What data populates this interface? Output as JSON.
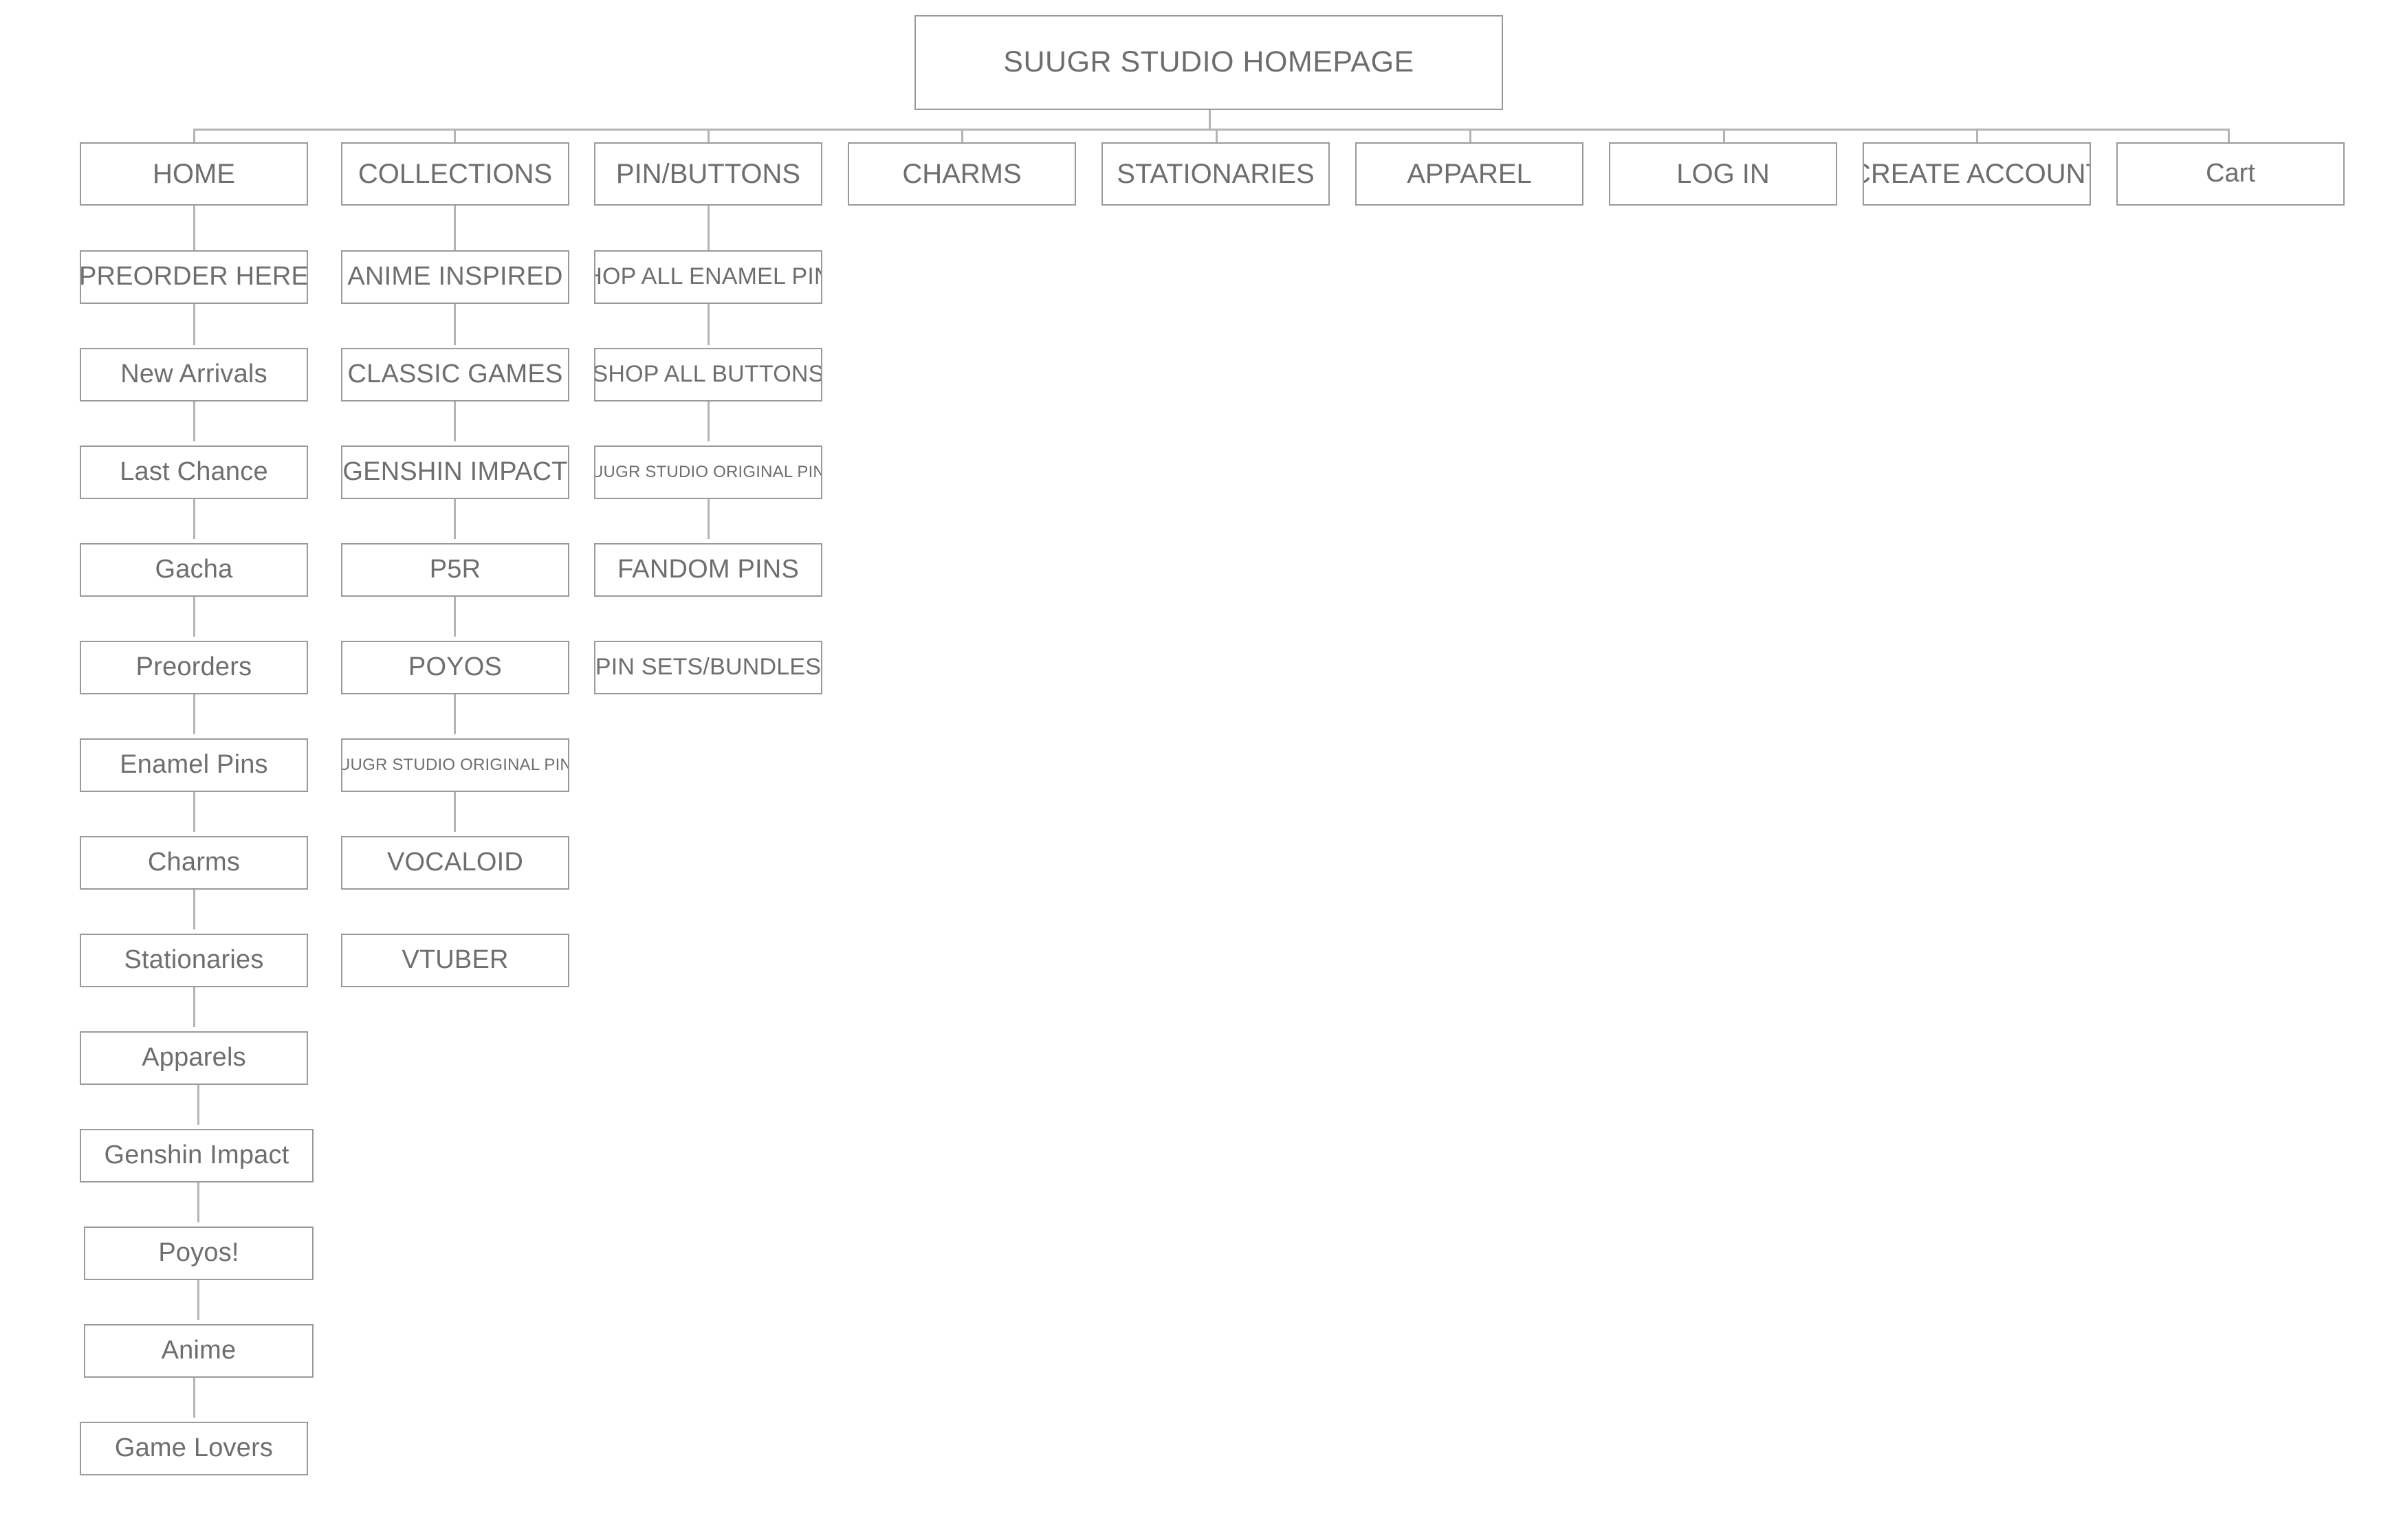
{
  "diagram": {
    "type": "sitemap-tree",
    "title": "SUUGR STUDIO HOMEPAGE",
    "colors": {
      "node_border": "#9a9a9a",
      "connector": "#b4b4b4",
      "text": "#6e6e6e",
      "background": "#ffffff"
    }
  },
  "root": {
    "label": "SUUGR STUDIO HOMEPAGE"
  },
  "nav": {
    "items": [
      {
        "label": "HOME"
      },
      {
        "label": "COLLECTIONS"
      },
      {
        "label": "PIN/BUTTONS"
      },
      {
        "label": "CHARMS"
      },
      {
        "label": "STATIONARIES"
      },
      {
        "label": "APPAREL"
      },
      {
        "label": "LOG IN"
      },
      {
        "label": "CREATE ACCOUNT"
      },
      {
        "label": "Cart"
      }
    ]
  },
  "columns": {
    "home": {
      "parent": "HOME",
      "children": [
        {
          "label": "PREORDER HERE"
        },
        {
          "label": "New Arrivals"
        },
        {
          "label": "Last Chance"
        },
        {
          "label": "Gacha"
        },
        {
          "label": "Preorders"
        },
        {
          "label": "Enamel Pins"
        },
        {
          "label": "Charms"
        },
        {
          "label": "Stationaries"
        },
        {
          "label": "Apparels"
        },
        {
          "label": "Genshin Impact"
        },
        {
          "label": "Poyos!"
        },
        {
          "label": "Anime"
        },
        {
          "label": "Game Lovers"
        }
      ]
    },
    "collections": {
      "parent": "COLLECTIONS",
      "children": [
        {
          "label": "ANIME INSPIRED"
        },
        {
          "label": "CLASSIC GAMES"
        },
        {
          "label": "GENSHIN IMPACT"
        },
        {
          "label": "P5R"
        },
        {
          "label": "POYOS"
        },
        {
          "label": "SUUGR STUDIO ORIGINAL PINS"
        },
        {
          "label": "VOCALOID"
        },
        {
          "label": "VTUBER"
        }
      ]
    },
    "pin_buttons": {
      "parent": "PIN/BUTTONS",
      "children": [
        {
          "label": "SHOP ALL ENAMEL PINS"
        },
        {
          "label": "SHOP ALL BUTTONS"
        },
        {
          "label": "SUUGR STUDIO ORIGINAL PINS"
        },
        {
          "label": "FANDOM PINS"
        },
        {
          "label": "PIN SETS/BUNDLES"
        }
      ]
    }
  }
}
